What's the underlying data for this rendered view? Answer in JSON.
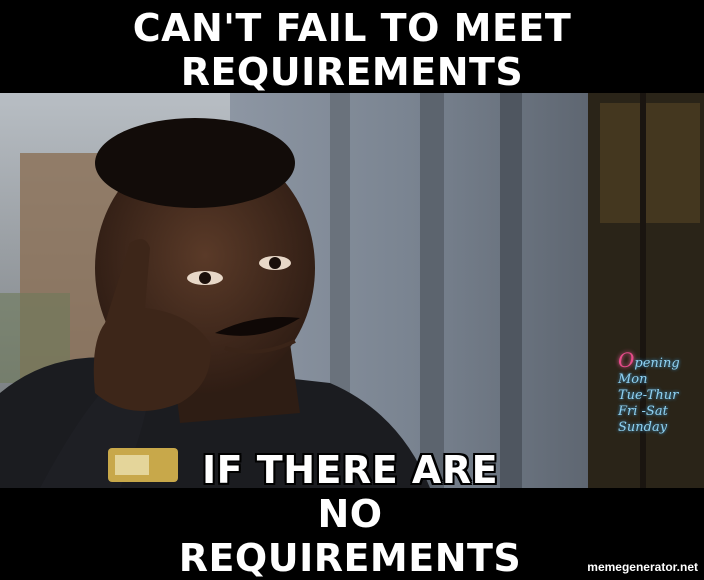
{
  "meme": {
    "top_text": "CAN'T FAIL TO MEET REQUIREMENTS",
    "bottom_text": "IF THERE ARE NO REQUIREMENTS",
    "watermark": "memegenerator.net"
  },
  "scene": {
    "sign_title_initial": "O",
    "sign_title_rest": "pening",
    "sign_lines": [
      "Mon",
      "Tue-Thur",
      "Fri -Sat",
      "Sunday"
    ]
  }
}
